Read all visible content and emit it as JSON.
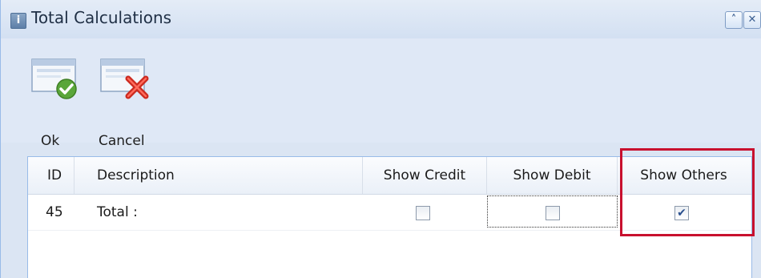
{
  "window": {
    "title": "Total Calculations",
    "info_icon_glyph": "i",
    "collapse_glyph": "˄",
    "close_glyph": "✕"
  },
  "toolbar": {
    "ok_label": "Ok",
    "cancel_label": "Cancel",
    "ok_icon": "window-check-icon",
    "cancel_icon": "window-delete-icon"
  },
  "grid": {
    "columns": [
      "ID",
      "Description",
      "Show Credit",
      "Show Debit",
      "Show Others"
    ],
    "rows": [
      {
        "id": "45",
        "description": "Total :",
        "show_credit": false,
        "show_debit": false,
        "show_others": true
      }
    ],
    "check_glyph": "✔"
  },
  "colors": {
    "highlight": "#c8102e",
    "window_bg": "#dbe5f3",
    "border": "#99bbe8"
  }
}
